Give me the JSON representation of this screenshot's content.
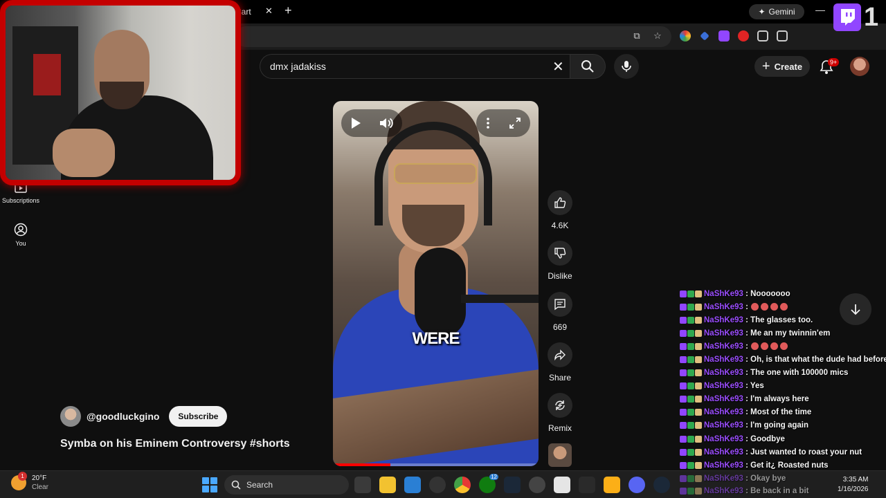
{
  "browser": {
    "tab_title": "Cart",
    "tab_close": "✕",
    "new_tab": "+",
    "gemini_label": "Gemini",
    "minimize": "—"
  },
  "youtube": {
    "search_value": "dmx jadakiss",
    "search_clear": "✕",
    "create_label": "Create",
    "notification_badge": "9+",
    "rail": [
      {
        "label": "Subscriptions",
        "icon": "subscriptions-icon"
      },
      {
        "label": "You",
        "icon": "account-icon"
      }
    ],
    "video": {
      "caption": "WERE",
      "progress": 0.28
    },
    "actions": {
      "like_count": "4.6K",
      "dislike_label": "Dislike",
      "comment_count": "669",
      "share_label": "Share",
      "remix_label": "Remix"
    },
    "channel": {
      "handle": "@goodluckgino",
      "subscribe_label": "Subscribe"
    },
    "title": "Symba on his Eminem Controversy #shorts"
  },
  "twitch": {
    "count": "1"
  },
  "chat": {
    "messages": [
      {
        "user": "NaShKe93",
        "text": ": Nooooooo",
        "emotes": 0
      },
      {
        "user": "NaShKe93",
        "text": ":",
        "emotes": 4
      },
      {
        "user": "NaShKe93",
        "text": ": The glasses too.",
        "emotes": 0
      },
      {
        "user": "NaShKe93",
        "text": ": Me an my twinnin'em",
        "emotes": 0
      },
      {
        "user": "NaShKe93",
        "text": ":",
        "emotes": 4
      },
      {
        "user": "NaShKe93",
        "text": ": Oh, is that what the dude had before?",
        "emotes": 0
      },
      {
        "user": "NaShKe93",
        "text": ": The one with 100000 mics",
        "emotes": 0
      },
      {
        "user": "NaShKe93",
        "text": ": Yes",
        "emotes": 0
      },
      {
        "user": "NaShKe93",
        "text": ": I'm always here",
        "emotes": 0
      },
      {
        "user": "NaShKe93",
        "text": ": Most of the time",
        "emotes": 0
      },
      {
        "user": "NaShKe93",
        "text": ": I'm going again",
        "emotes": 0
      },
      {
        "user": "NaShKe93",
        "text": ": Goodbye",
        "emotes": 0
      },
      {
        "user": "NaShKe93",
        "text": ": Just wanted to roast your nut",
        "emotes": 0
      },
      {
        "user": "NaShKe93",
        "text": ": Get it¿ Roasted nuts",
        "emotes": 0
      }
    ],
    "overflow": [
      {
        "user": "NaShKe93",
        "text": ": Okay bye"
      },
      {
        "user": "NaShKe93",
        "text": ": Be back in a bit"
      }
    ]
  },
  "taskbar": {
    "weather_temp": "20°F",
    "weather_cond": "Clear",
    "weather_badge": "1",
    "search_label": "Search",
    "app_badge": "12",
    "time": "3:35 AM",
    "date": "1/16/2026"
  },
  "colors": {
    "accent_red": "#c40000",
    "twitch_purple": "#9146ff",
    "chat_user": "#9b4dff"
  }
}
